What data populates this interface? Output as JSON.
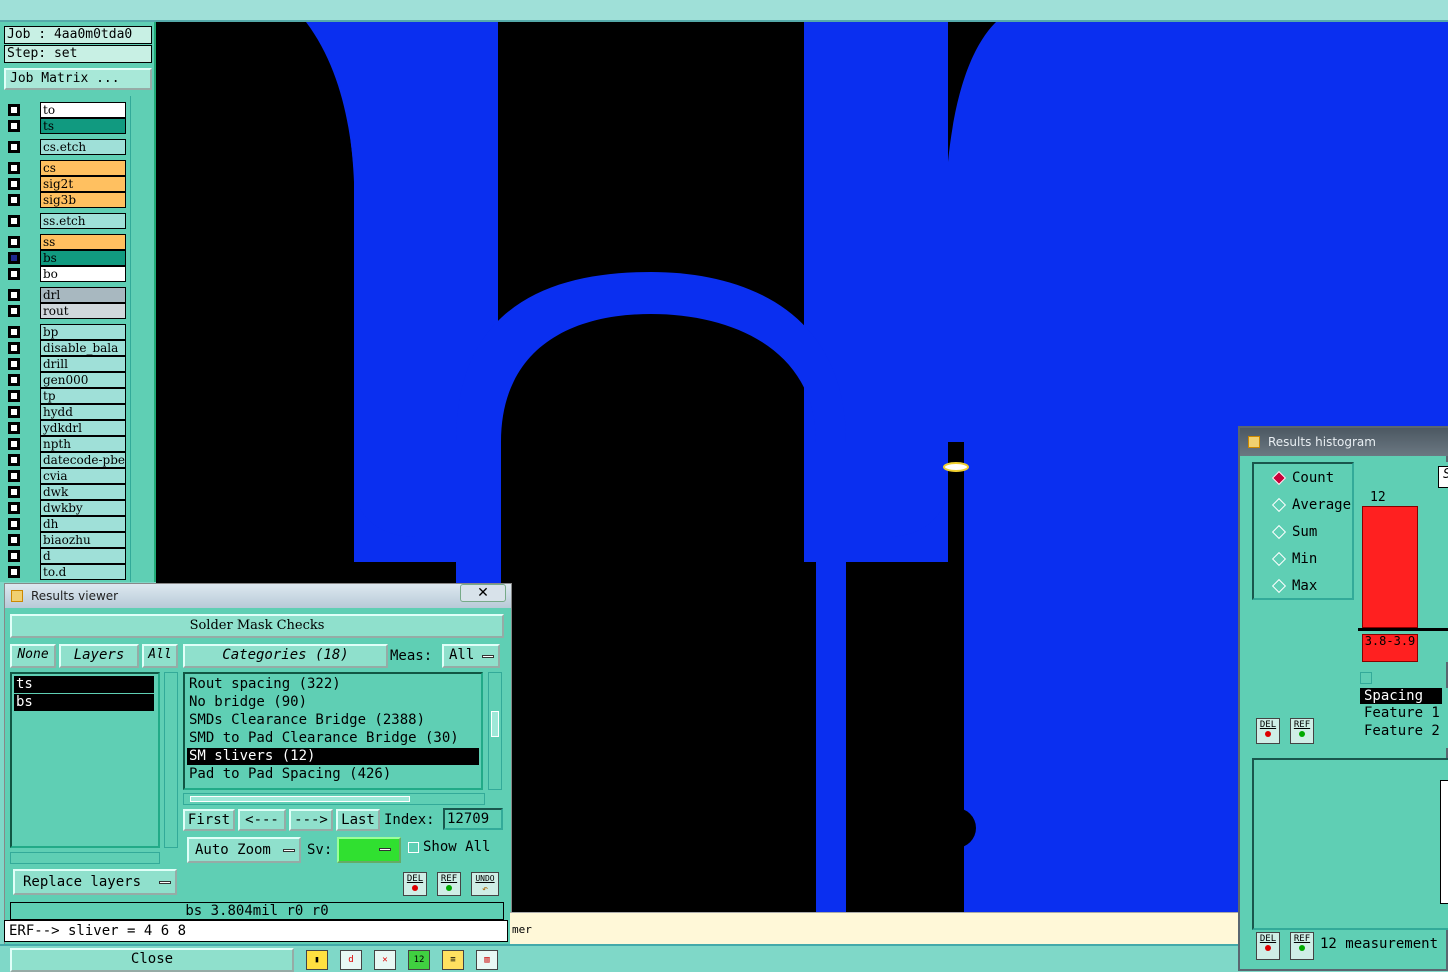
{
  "topbar": {
    "fragments": [
      "_",
      "_",
      "_",
      "_",
      "_",
      "_",
      "_",
      "_",
      "_"
    ]
  },
  "job": {
    "job_label": "Job : 4aa0m0tda0",
    "step_label": "Step: set",
    "matrix_button": "Job Matrix ..."
  },
  "layers": [
    {
      "name": "to",
      "color": "#ffffff",
      "selected": false
    },
    {
      "name": "ts",
      "color": "#119a80",
      "selected": false
    },
    {
      "name": "cs.etch",
      "color": "#9fe0d8",
      "selected": false
    },
    {
      "name": "cs",
      "color": "#ffc060",
      "selected": false
    },
    {
      "name": "sig2t",
      "color": "#ffc060",
      "selected": false
    },
    {
      "name": "sig3b",
      "color": "#ffc060",
      "selected": false
    },
    {
      "name": "ss.etch",
      "color": "#9fe0d8",
      "selected": false
    },
    {
      "name": "ss",
      "color": "#ffc060",
      "selected": false
    },
    {
      "name": "bs",
      "color": "#119a80",
      "selected": true
    },
    {
      "name": "bo",
      "color": "#ffffff",
      "selected": false
    },
    {
      "name": "drl",
      "color": "#a8b8c0",
      "selected": false
    },
    {
      "name": "rout",
      "color": "#d0d8dc",
      "selected": false
    },
    {
      "name": "bp",
      "color": "#9fe0d8",
      "selected": false
    },
    {
      "name": "disable_bala",
      "color": "#9fe0d8",
      "selected": false
    },
    {
      "name": "drill",
      "color": "#9fe0d8",
      "selected": false
    },
    {
      "name": "gen000",
      "color": "#9fe0d8",
      "selected": false
    },
    {
      "name": "tp",
      "color": "#9fe0d8",
      "selected": false
    },
    {
      "name": "hydd",
      "color": "#9fe0d8",
      "selected": false
    },
    {
      "name": "ydkdrl",
      "color": "#9fe0d8",
      "selected": false
    },
    {
      "name": "npth",
      "color": "#9fe0d8",
      "selected": false
    },
    {
      "name": "datecode-pbe",
      "color": "#9fe0d8",
      "selected": false
    },
    {
      "name": "cvia",
      "color": "#9fe0d8",
      "selected": false
    },
    {
      "name": "dwk",
      "color": "#9fe0d8",
      "selected": false
    },
    {
      "name": "dwkby",
      "color": "#9fe0d8",
      "selected": false
    },
    {
      "name": "dh",
      "color": "#9fe0d8",
      "selected": false
    },
    {
      "name": "biaozhu",
      "color": "#9fe0d8",
      "selected": false
    },
    {
      "name": "d",
      "color": "#9fe0d8",
      "selected": false
    },
    {
      "name": "to.d",
      "color": "#9fe0d8",
      "selected": false
    }
  ],
  "results_viewer": {
    "title": "Results viewer",
    "close_glyph": "✕",
    "heading": "Solder Mask Checks",
    "none_btn": "None",
    "layers_btn": "Layers",
    "all_btn": "All",
    "categories_btn": "Categories (18)",
    "meas_label": "Meas:",
    "meas_value": "All",
    "layer_items": [
      "ts",
      "bs"
    ],
    "categories": [
      {
        "label": "Rout spacing (322)",
        "selected": false
      },
      {
        "label": "No bridge (90)",
        "selected": false
      },
      {
        "label": "SMDs Clearance Bridge (2388)",
        "selected": false
      },
      {
        "label": "SMD to Pad Clearance Bridge (30)",
        "selected": false
      },
      {
        "label": "SM slivers (12)",
        "selected": true
      },
      {
        "label": "Pad to Pad Spacing (426)",
        "selected": false
      }
    ],
    "first_btn": "First",
    "prev_btn": "<---",
    "next_btn": "--->",
    "last_btn": "Last",
    "index_label": "Index:",
    "index_value": "12709",
    "replace_btn": "Replace layers",
    "autozoom_btn": "Auto Zoom",
    "sv_label": "Sv:",
    "show_all_label": "Show All",
    "del_btn": "DEL",
    "ref_btn": "REF",
    "undo_btn": "UNDO",
    "measurement": "bs 3.804mil   r0   r0",
    "erf_line": "ERF--> sliver = 4 6 8",
    "close_btn": "Close"
  },
  "status_text": "mer",
  "histogram": {
    "title": "Results histogram",
    "modes": [
      {
        "label": "Count",
        "on": true
      },
      {
        "label": "Average",
        "on": false
      },
      {
        "label": "Sum",
        "on": false
      },
      {
        "label": "Min",
        "on": false
      },
      {
        "label": "Max",
        "on": false
      }
    ],
    "bar_value": "12",
    "bar_count": 12,
    "bar_range": "3.8-3.9",
    "sort_btn": "S",
    "info_lines": [
      "Spacing",
      "Feature 1",
      "Feature 2"
    ],
    "del_btn": "DEL",
    "ref_btn": "REF",
    "measurements": "12 measurement"
  },
  "colors": {
    "panel": "#5fcfb4",
    "copper": "#0a2ff0",
    "bar": "#ff2020"
  }
}
